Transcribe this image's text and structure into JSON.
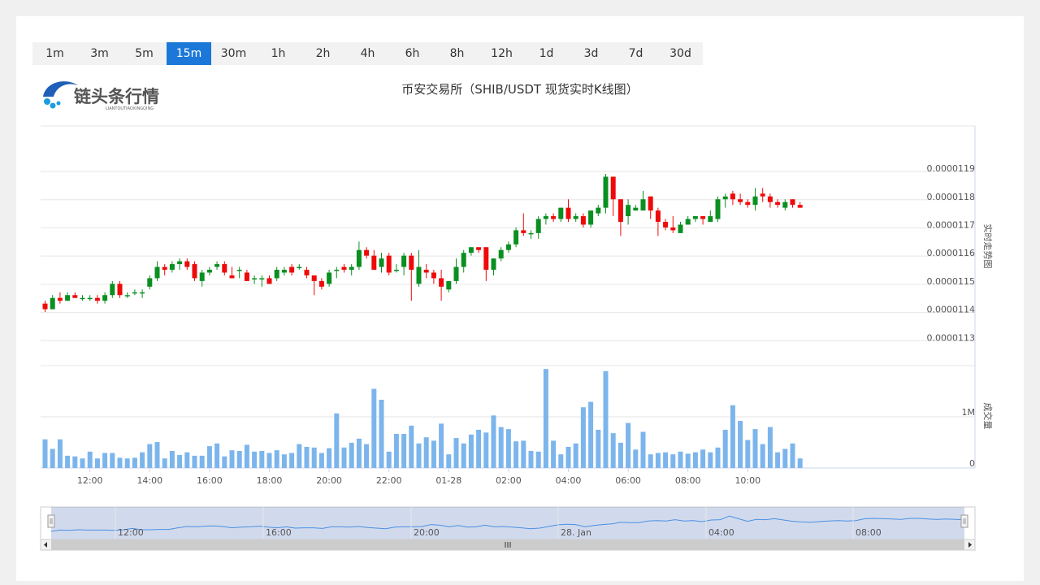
{
  "intervals": {
    "items": [
      "1m",
      "3m",
      "5m",
      "15m",
      "30m",
      "1h",
      "2h",
      "4h",
      "6h",
      "8h",
      "12h",
      "1d",
      "3d",
      "7d",
      "30d"
    ],
    "selected": "15m"
  },
  "logo": {
    "name": "链头条行情",
    "subtitle": "LIANTOUTIAOXINGQING"
  },
  "colors": {
    "up": "#0a8f21",
    "down": "#ee0a0a",
    "volume": "#7cb5ec",
    "accent": "#1b78d8"
  },
  "chart_data": {
    "type": "candlestick",
    "title": "币安交易所（SHIB/USDT 现货实时K线图）",
    "price_axis_label": "实时走势图",
    "volume_axis_label": "成交量",
    "x_tick_labels": [
      "12:00",
      "14:00",
      "16:00",
      "18:00",
      "20:00",
      "22:00",
      "01-28",
      "02:00",
      "04:00",
      "06:00",
      "08:00",
      "10:00"
    ],
    "y_tick_labels": [
      "0.0000113",
      "0.0000114",
      "0.0000115",
      "0.0000116",
      "0.0000117",
      "0.0000118",
      "0.0000119"
    ],
    "y_range": [
      1.12e-05,
      1.205e-05
    ],
    "volume_tick_labels": [
      "0",
      "1M"
    ],
    "volume_range": [
      0,
      1500000
    ],
    "start_time": "10:30",
    "interval": "15m",
    "candles": [
      [
        1.142e-05,
        1.14e-05,
        1.143e-05,
        1.139e-05
      ],
      [
        1.14e-05,
        1.144e-05,
        1.145e-05,
        1.14e-05
      ],
      [
        1.144e-05,
        1.143e-05,
        1.146e-05,
        1.142e-05
      ],
      [
        1.143e-05,
        1.145e-05,
        1.146e-05,
        1.143e-05
      ],
      [
        1.145e-05,
        1.144e-05,
        1.146e-05,
        1.144e-05
      ],
      [
        1.144e-05,
        1.144e-05,
        1.145e-05,
        1.143e-05
      ],
      [
        1.144e-05,
        1.144e-05,
        1.145e-05,
        1.143e-05
      ],
      [
        1.144e-05,
        1.143e-05,
        1.145e-05,
        1.142e-05
      ],
      [
        1.143e-05,
        1.145e-05,
        1.146e-05,
        1.142e-05
      ],
      [
        1.145e-05,
        1.149e-05,
        1.15e-05,
        1.144e-05
      ],
      [
        1.149e-05,
        1.145e-05,
        1.15e-05,
        1.144e-05
      ],
      [
        1.145e-05,
        1.145e-05,
        1.146e-05,
        1.144e-05
      ],
      [
        1.146e-05,
        1.146e-05,
        1.147e-05,
        1.145e-05
      ],
      [
        1.146e-05,
        1.146e-05,
        1.147e-05,
        1.144e-05
      ],
      [
        1.148e-05,
        1.151e-05,
        1.152e-05,
        1.147e-05
      ],
      [
        1.151e-05,
        1.155e-05,
        1.157e-05,
        1.15e-05
      ],
      [
        1.155e-05,
        1.154e-05,
        1.156e-05,
        1.152e-05
      ],
      [
        1.154e-05,
        1.156e-05,
        1.157e-05,
        1.153e-05
      ],
      [
        1.156e-05,
        1.157e-05,
        1.158e-05,
        1.154e-05
      ],
      [
        1.157e-05,
        1.155e-05,
        1.158e-05,
        1.154e-05
      ],
      [
        1.156e-05,
        1.151e-05,
        1.157e-05,
        1.15e-05
      ],
      [
        1.15e-05,
        1.153e-05,
        1.154e-05,
        1.148e-05
      ],
      [
        1.153e-05,
        1.154e-05,
        1.155e-05,
        1.152e-05
      ],
      [
        1.155e-05,
        1.156e-05,
        1.157e-05,
        1.154e-05
      ],
      [
        1.156e-05,
        1.153e-05,
        1.157e-05,
        1.152e-05
      ],
      [
        1.152e-05,
        1.151e-05,
        1.155e-05,
        1.151e-05
      ],
      [
        1.154e-05,
        1.154e-05,
        1.155e-05,
        1.151e-05
      ],
      [
        1.153e-05,
        1.15e-05,
        1.154e-05,
        1.15e-05
      ],
      [
        1.151e-05,
        1.151e-05,
        1.152e-05,
        1.149e-05
      ],
      [
        1.151e-05,
        1.151e-05,
        1.152e-05,
        1.148e-05
      ],
      [
        1.151e-05,
        1.149e-05,
        1.152e-05,
        1.149e-05
      ],
      [
        1.151e-05,
        1.154e-05,
        1.155e-05,
        1.15e-05
      ],
      [
        1.153e-05,
        1.154e-05,
        1.155e-05,
        1.152e-05
      ],
      [
        1.155e-05,
        1.153e-05,
        1.156e-05,
        1.152e-05
      ],
      [
        1.155e-05,
        1.155e-05,
        1.156e-05,
        1.154e-05
      ],
      [
        1.154e-05,
        1.152e-05,
        1.155e-05,
        1.151e-05
      ],
      [
        1.152e-05,
        1.15e-05,
        1.152e-05,
        1.145e-05
      ],
      [
        1.15e-05,
        1.148e-05,
        1.151e-05,
        1.147e-05
      ],
      [
        1.149e-05,
        1.153e-05,
        1.154e-05,
        1.148e-05
      ],
      [
        1.154e-05,
        1.154e-05,
        1.155e-05,
        1.151e-05
      ],
      [
        1.155e-05,
        1.154e-05,
        1.156e-05,
        1.153e-05
      ],
      [
        1.154e-05,
        1.155e-05,
        1.156e-05,
        1.152e-05
      ],
      [
        1.155e-05,
        1.161e-05,
        1.164e-05,
        1.154e-05
      ],
      [
        1.161e-05,
        1.159e-05,
        1.162e-05,
        1.158e-05
      ],
      [
        1.159e-05,
        1.154e-05,
        1.161e-05,
        1.154e-05
      ],
      [
        1.155e-05,
        1.158e-05,
        1.16e-05,
        1.153e-05
      ],
      [
        1.159e-05,
        1.153e-05,
        1.16e-05,
        1.152e-05
      ],
      [
        1.154e-05,
        1.154e-05,
        1.156e-05,
        1.153e-05
      ],
      [
        1.155e-05,
        1.159e-05,
        1.16e-05,
        1.152e-05
      ],
      [
        1.159e-05,
        1.154e-05,
        1.16e-05,
        1.143e-05
      ],
      [
        1.149e-05,
        1.155e-05,
        1.161e-05,
        1.148e-05
      ],
      [
        1.154e-05,
        1.153e-05,
        1.156e-05,
        1.151e-05
      ],
      [
        1.153e-05,
        1.151e-05,
        1.154e-05,
        1.149e-05
      ],
      [
        1.151e-05,
        1.148e-05,
        1.154e-05,
        1.143e-05
      ],
      [
        1.147e-05,
        1.15e-05,
        1.15e-05,
        1.146e-05
      ],
      [
        1.15e-05,
        1.155e-05,
        1.158e-05,
        1.149e-05
      ],
      [
        1.155e-05,
        1.16e-05,
        1.161e-05,
        1.153e-05
      ],
      [
        1.16e-05,
        1.162e-05,
        1.162e-05,
        1.159e-05
      ],
      [
        1.162e-05,
        1.161e-05,
        1.162e-05,
        1.16e-05
      ],
      [
        1.162e-05,
        1.154e-05,
        1.162e-05,
        1.15e-05
      ],
      [
        1.154e-05,
        1.158e-05,
        1.158e-05,
        1.152e-05
      ],
      [
        1.158e-05,
        1.161e-05,
        1.162e-05,
        1.157e-05
      ],
      [
        1.161e-05,
        1.163e-05,
        1.164e-05,
        1.16e-05
      ],
      [
        1.163e-05,
        1.168e-05,
        1.169e-05,
        1.162e-05
      ],
      [
        1.168e-05,
        1.167e-05,
        1.174e-05,
        1.166e-05
      ],
      [
        1.167e-05,
        1.167e-05,
        1.168e-05,
        1.165e-05
      ],
      [
        1.167e-05,
        1.172e-05,
        1.173e-05,
        1.165e-05
      ],
      [
        1.172e-05,
        1.173e-05,
        1.174e-05,
        1.17e-05
      ],
      [
        1.173e-05,
        1.172e-05,
        1.174e-05,
        1.171e-05
      ],
      [
        1.172e-05,
        1.176e-05,
        1.176e-05,
        1.171e-05
      ],
      [
        1.176e-05,
        1.172e-05,
        1.179e-05,
        1.171e-05
      ],
      [
        1.172e-05,
        1.173e-05,
        1.174e-05,
        1.171e-05
      ],
      [
        1.173e-05,
        1.17e-05,
        1.174e-05,
        1.169e-05
      ],
      [
        1.17e-05,
        1.175e-05,
        1.175e-05,
        1.169e-05
      ],
      [
        1.174e-05,
        1.176e-05,
        1.177e-05,
        1.173e-05
      ],
      [
        1.176e-05,
        1.187e-05,
        1.188e-05,
        1.174e-05
      ],
      [
        1.187e-05,
        1.179e-05,
        1.187e-05,
        1.173e-05
      ],
      [
        1.179e-05,
        1.171e-05,
        1.179e-05,
        1.166e-05
      ],
      [
        1.173e-05,
        1.177e-05,
        1.179e-05,
        1.17e-05
      ],
      [
        1.175e-05,
        1.176e-05,
        1.177e-05,
        1.175e-05
      ],
      [
        1.175e-05,
        1.179e-05,
        1.182e-05,
        1.175e-05
      ],
      [
        1.18e-05,
        1.175e-05,
        1.18e-05,
        1.172e-05
      ],
      [
        1.175e-05,
        1.171e-05,
        1.176e-05,
        1.166e-05
      ],
      [
        1.171e-05,
        1.169e-05,
        1.172e-05,
        1.168e-05
      ],
      [
        1.169e-05,
        1.168e-05,
        1.173e-05,
        1.167e-05
      ],
      [
        1.167e-05,
        1.17e-05,
        1.171e-05,
        1.167e-05
      ],
      [
        1.17e-05,
        1.172e-05,
        1.173e-05,
        1.17e-05
      ],
      [
        1.172e-05,
        1.173e-05,
        1.173e-05,
        1.171e-05
      ],
      [
        1.173e-05,
        1.172e-05,
        1.173e-05,
        1.17e-05
      ],
      [
        1.171e-05,
        1.173e-05,
        1.175e-05,
        1.171e-05
      ],
      [
        1.172e-05,
        1.179e-05,
        1.18e-05,
        1.171e-05
      ],
      [
        1.179e-05,
        1.18e-05,
        1.181e-05,
        1.176e-05
      ],
      [
        1.181e-05,
        1.179e-05,
        1.182e-05,
        1.177e-05
      ],
      [
        1.179e-05,
        1.178e-05,
        1.181e-05,
        1.177e-05
      ],
      [
        1.178e-05,
        1.177e-05,
        1.179e-05,
        1.176e-05
      ],
      [
        1.177e-05,
        1.18e-05,
        1.183e-05,
        1.175e-05
      ],
      [
        1.181e-05,
        1.18e-05,
        1.183e-05,
        1.178e-05
      ],
      [
        1.18e-05,
        1.178e-05,
        1.181e-05,
        1.176e-05
      ],
      [
        1.178e-05,
        1.177e-05,
        1.179e-05,
        1.176e-05
      ],
      [
        1.176e-05,
        1.178e-05,
        1.179e-05,
        1.175e-05
      ],
      [
        1.179e-05,
        1.177e-05,
        1.179e-05,
        1.176e-05
      ],
      [
        1.177e-05,
        1.176e-05,
        1.178e-05,
        1.176e-05
      ]
    ],
    "volumes": [
      420000,
      280000,
      420000,
      180000,
      170000,
      140000,
      240000,
      140000,
      220000,
      220000,
      150000,
      140000,
      150000,
      230000,
      350000,
      380000,
      140000,
      250000,
      190000,
      230000,
      180000,
      180000,
      320000,
      360000,
      170000,
      260000,
      250000,
      340000,
      240000,
      250000,
      220000,
      260000,
      200000,
      220000,
      350000,
      310000,
      300000,
      220000,
      290000,
      800000,
      300000,
      370000,
      430000,
      350000,
      1160000,
      1000000,
      240000,
      500000,
      500000,
      620000,
      360000,
      450000,
      400000,
      650000,
      200000,
      440000,
      360000,
      490000,
      560000,
      520000,
      770000,
      600000,
      570000,
      390000,
      400000,
      250000,
      240000,
      1450000,
      400000,
      200000,
      310000,
      360000,
      890000,
      970000,
      560000,
      1420000,
      510000,
      370000,
      660000,
      270000,
      530000,
      200000,
      220000,
      230000,
      200000,
      240000,
      210000,
      230000,
      270000,
      230000,
      300000,
      560000,
      920000,
      690000,
      410000,
      570000,
      350000,
      600000,
      230000,
      280000,
      360000,
      140000
    ],
    "navigator": {
      "labels": [
        "12:00",
        "16:00",
        "20:00",
        "28. Jan",
        "04:00",
        "08:00"
      ]
    }
  }
}
